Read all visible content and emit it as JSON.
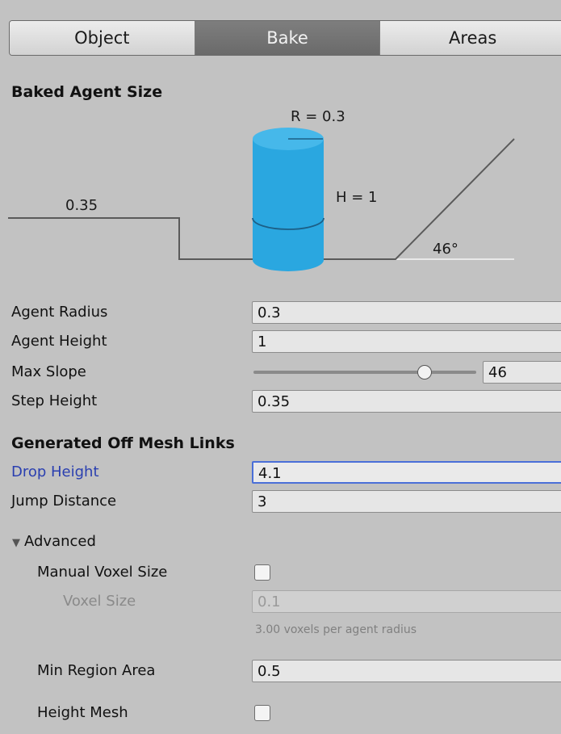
{
  "tabs": [
    {
      "label": "Object",
      "active": false
    },
    {
      "label": "Bake",
      "active": true
    },
    {
      "label": "Areas",
      "active": false
    }
  ],
  "baked_agent_size": {
    "title": "Baked Agent Size",
    "diagram": {
      "radius_label": "R = 0.3",
      "height_label": "H = 1",
      "step_label": "0.35",
      "slope_label": "46°",
      "cylinder_color": "#2aa7e0"
    }
  },
  "fields": {
    "agent_radius": {
      "label": "Agent Radius",
      "value": "0.3"
    },
    "agent_height": {
      "label": "Agent Height",
      "value": "1"
    },
    "max_slope": {
      "label": "Max Slope",
      "value": "46",
      "fraction": 0.767
    },
    "step_height": {
      "label": "Step Height",
      "value": "0.35"
    }
  },
  "offmesh": {
    "title": "Generated Off Mesh Links",
    "drop_height": {
      "label": "Drop Height",
      "value": "4.1"
    },
    "jump_distance": {
      "label": "Jump Distance",
      "value": "3"
    }
  },
  "advanced": {
    "label": "Advanced",
    "arrow_icon": "triangle-down-icon",
    "manual_voxel_size": {
      "label": "Manual Voxel Size",
      "checked": false
    },
    "voxel_size": {
      "label": "Voxel Size",
      "value": "0.1",
      "hint": "3.00 voxels per agent radius"
    },
    "min_region_area": {
      "label": "Min Region Area",
      "value": "0.5"
    },
    "height_mesh": {
      "label": "Height Mesh",
      "checked": false
    }
  },
  "colors": {
    "background": "#c2c2c2",
    "active_tab": "#727272",
    "focus_label": "#2a3fb0",
    "focus_border": "#4a6fd8"
  }
}
